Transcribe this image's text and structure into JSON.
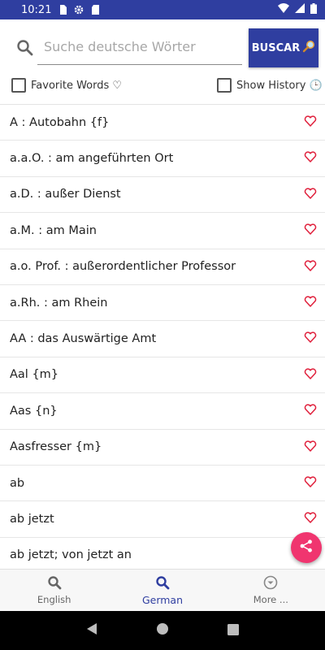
{
  "status_bar": {
    "time": "10:21",
    "icons": [
      "sim-card-icon",
      "settings-icon",
      "sd-card-icon",
      "wifi-icon",
      "cell-signal-icon",
      "battery-icon"
    ]
  },
  "search": {
    "placeholder": "Suche deutsche Wörter",
    "button_label": "BUSCAR",
    "button_icon": "magnifier-emoji-icon"
  },
  "options": {
    "favorites_label": "Favorite Words ♡",
    "favorites_checked": false,
    "history_label": "Show History 🕒",
    "history_checked": false
  },
  "word_list": [
    {
      "text": "A : Autobahn {f}",
      "favorite": false
    },
    {
      "text": "a.a.O. : am angeführten Ort",
      "favorite": false
    },
    {
      "text": "a.D. : außer Dienst",
      "favorite": false
    },
    {
      "text": "a.M. : am Main",
      "favorite": false
    },
    {
      "text": "a.o. Prof. : außerordentlicher Professor",
      "favorite": false
    },
    {
      "text": "a.Rh. : am Rhein",
      "favorite": false
    },
    {
      "text": "AA : das Auswärtige Amt",
      "favorite": false
    },
    {
      "text": "Aal {m}",
      "favorite": false
    },
    {
      "text": "Aas {n}",
      "favorite": false
    },
    {
      "text": "Aasfresser {m}",
      "favorite": false
    },
    {
      "text": "ab",
      "favorite": false
    },
    {
      "text": "ab jetzt",
      "favorite": false
    },
    {
      "text": "ab jetzt; von jetzt an",
      "favorite": false
    }
  ],
  "fab": {
    "icon": "share-icon"
  },
  "bottom_nav": {
    "items": [
      {
        "label": "English",
        "icon": "search-icon",
        "active": false
      },
      {
        "label": "German",
        "icon": "search-icon",
        "active": true
      },
      {
        "label": "More ...",
        "icon": "expand-circle-icon",
        "active": false
      }
    ]
  },
  "colors": {
    "primary": "#2f3ea0",
    "heart": "#e0203c",
    "fab": "#f0356f"
  }
}
